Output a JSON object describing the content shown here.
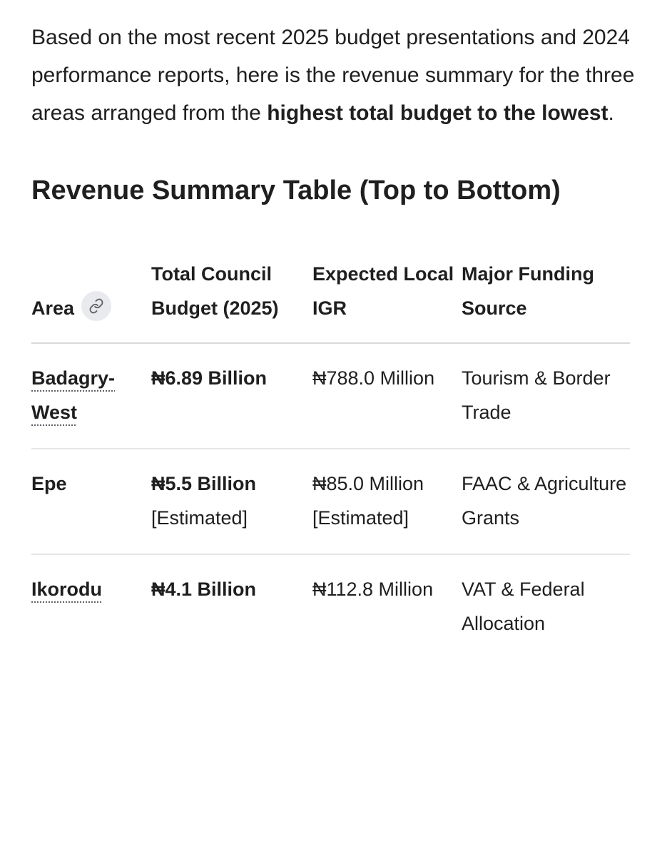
{
  "intro": {
    "text_before": "Based on the most recent 2025 budget presentations and 2024 performance reports, here is the revenue summary for the three areas arranged from the ",
    "bold_text": "highest total budget to the lowest",
    "text_after": "."
  },
  "heading": "Revenue Summary Table (Top to Bottom)",
  "table": {
    "headers": {
      "area": "Area",
      "budget": "Total Council Budget (2025)",
      "igr": "Expected Local IGR",
      "source": "Major Funding Source"
    },
    "rows": [
      {
        "area": "Badagry-West",
        "budget": "₦6.89 Billion",
        "budget_note": "",
        "igr": "₦788.0 Million",
        "source": "Tourism & Border Trade"
      },
      {
        "area": "Epe",
        "budget": "₦5.5 Billion",
        "budget_note": "[Estimated]",
        "igr": "₦85.0 Million [Estimated]",
        "source": "FAAC & Agriculture Grants"
      },
      {
        "area": "Ikorodu",
        "budget": "₦4.1 Billion",
        "budget_note": "",
        "igr": "₦112.8 Million",
        "source": "VAT & Federal Allocation"
      }
    ]
  },
  "icons": {
    "area_header_icon": "link-icon"
  },
  "colors": {
    "text": "#1f1f1f",
    "chip_bg": "#e8eaed",
    "divider": "#d9d9d9"
  }
}
